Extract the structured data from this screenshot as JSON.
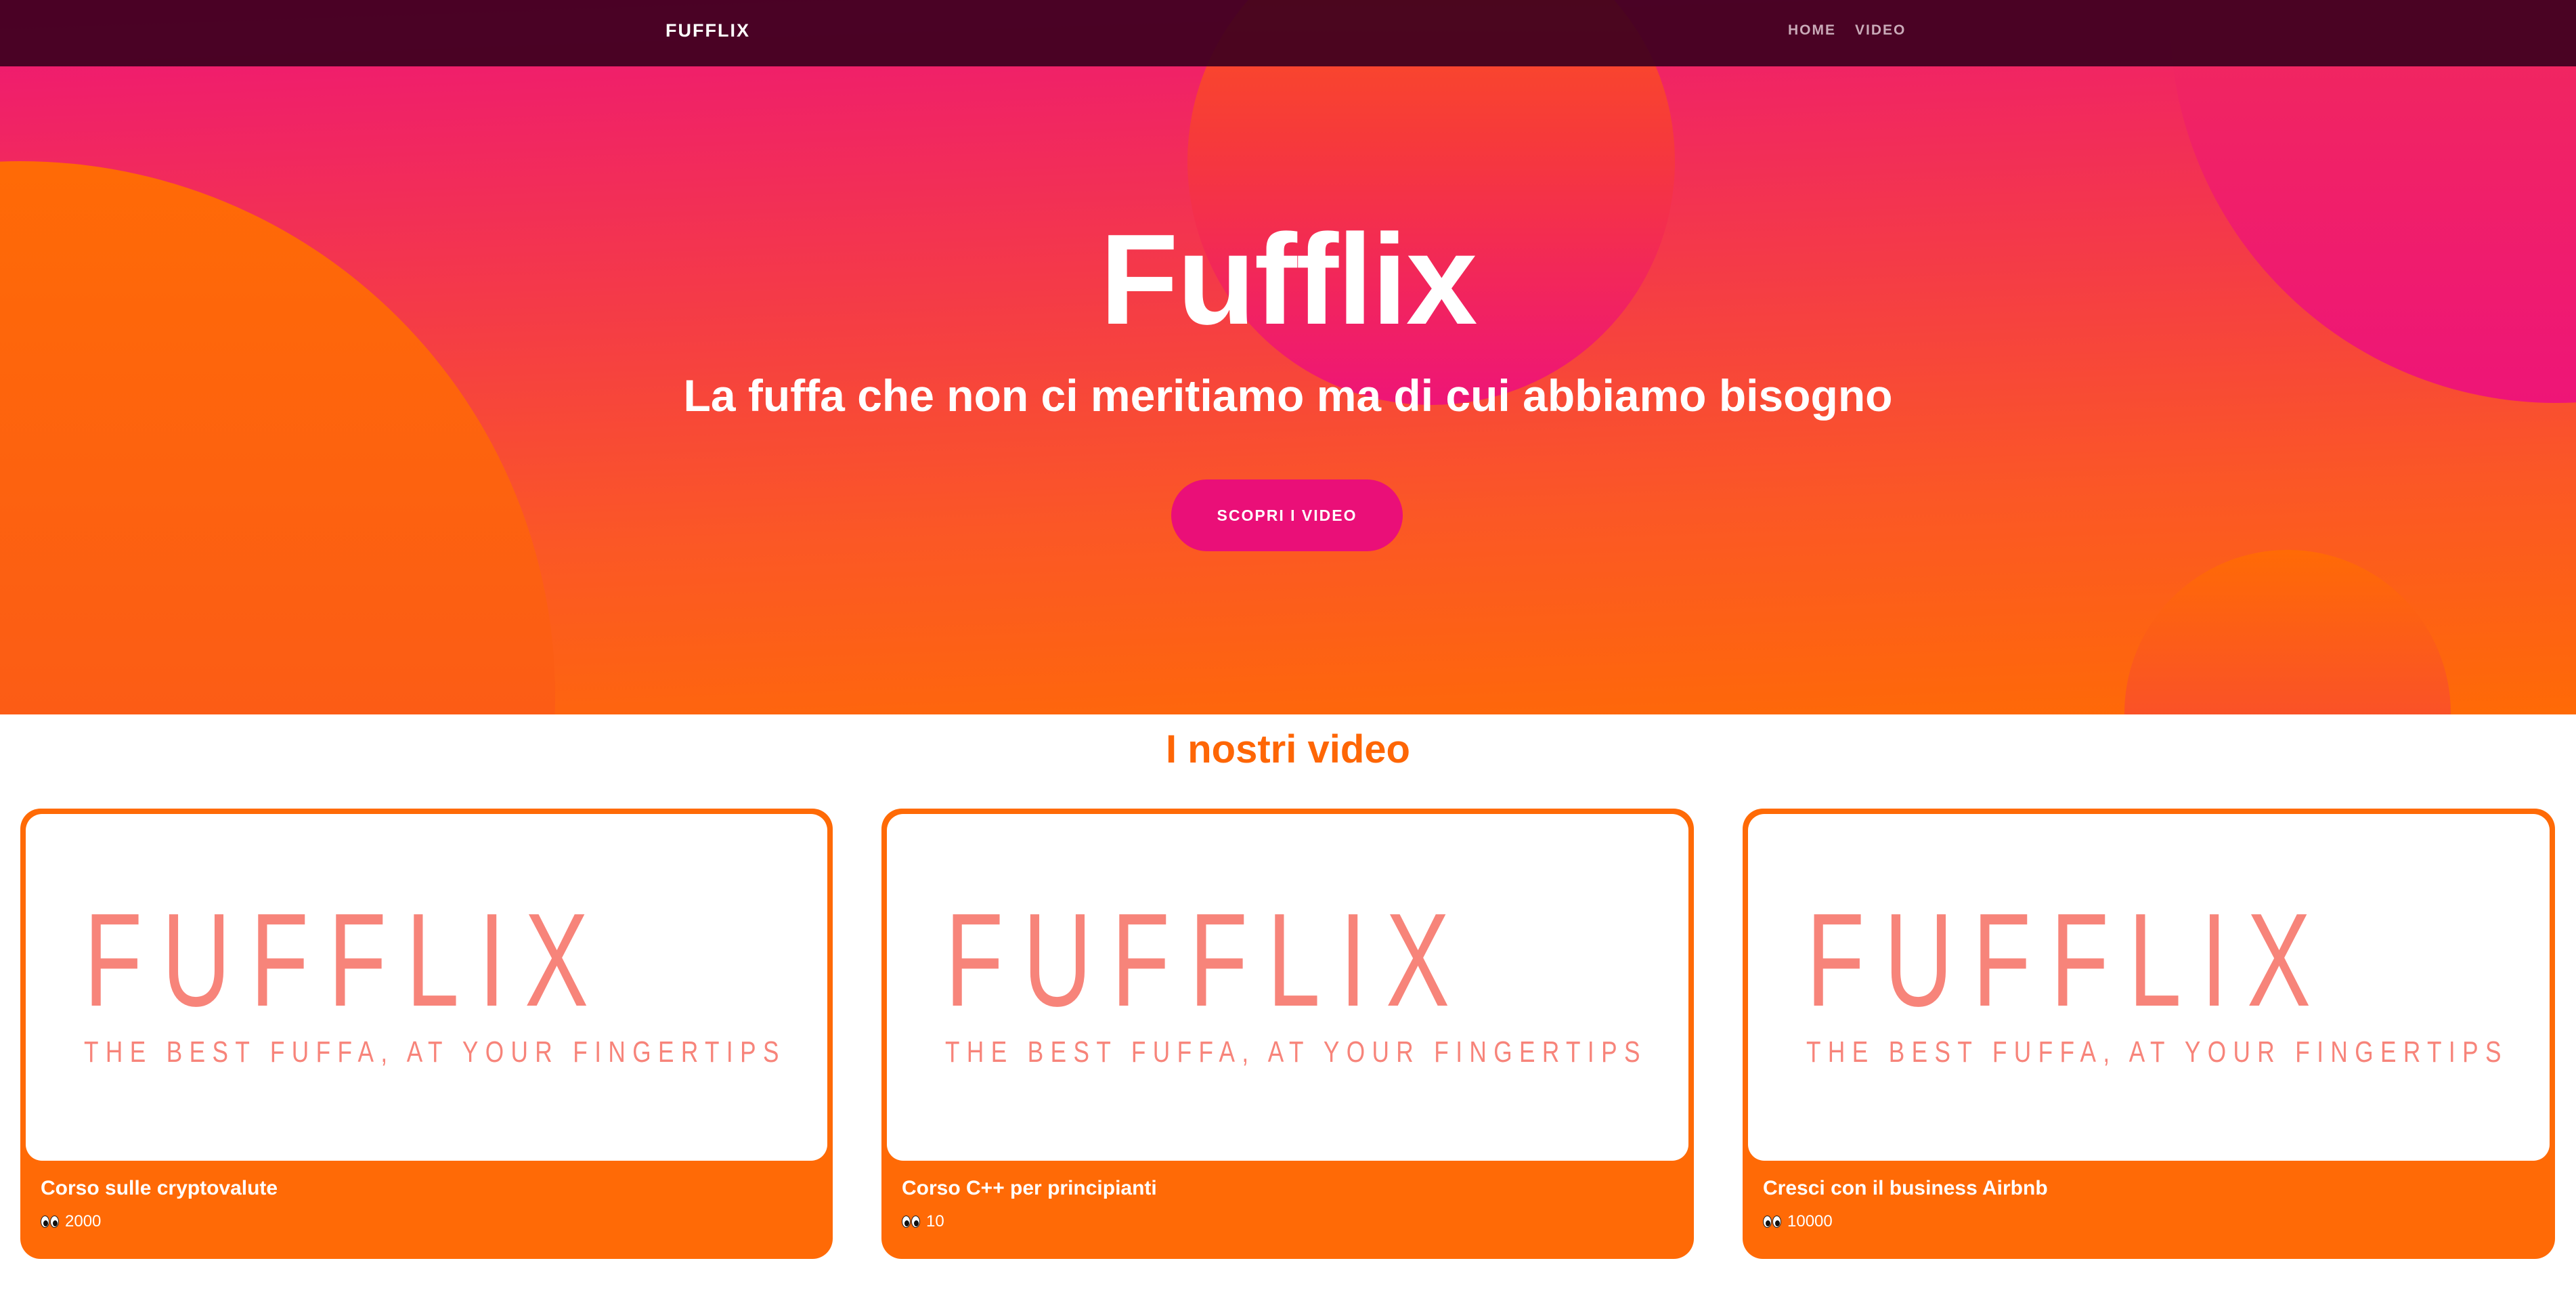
{
  "navbar": {
    "brand": "FUFFLIX",
    "links": [
      {
        "label": "HOME"
      },
      {
        "label": "VIDEO"
      }
    ]
  },
  "hero": {
    "title": "Fufflix",
    "subtitle": "La fuffa che non ci meritiamo ma di cui abbiamo bisogno",
    "button_label": "SCOPRI I VIDEO"
  },
  "videos": {
    "title": "I nostri video",
    "items": [
      {
        "thumb_logo": "FUFFLIX",
        "thumb_tagline": "THE BEST FUFFA, AT YOUR FINGERTIPS",
        "title": "Corso sulle cryptovalute",
        "views": "2000",
        "views_icon": "eyes-icon"
      },
      {
        "thumb_logo": "FUFFLIX",
        "thumb_tagline": "THE BEST FUFFA, AT YOUR FINGERTIPS",
        "title": "Corso C++ per principianti",
        "views": "10",
        "views_icon": "eyes-icon"
      },
      {
        "thumb_logo": "FUFFLIX",
        "thumb_tagline": "THE BEST FUFFA, AT YOUR FINGERTIPS",
        "title": "Cresci con il business Airbnb",
        "views": "10000",
        "views_icon": "eyes-icon"
      }
    ]
  },
  "colors": {
    "navbar_bg": "#3c001e",
    "hero_pink": "#ee1577",
    "hero_orange": "#ff6a06",
    "button": "#ea0f78",
    "accent": "#fe6605",
    "thumb_text": "#f7847a"
  }
}
